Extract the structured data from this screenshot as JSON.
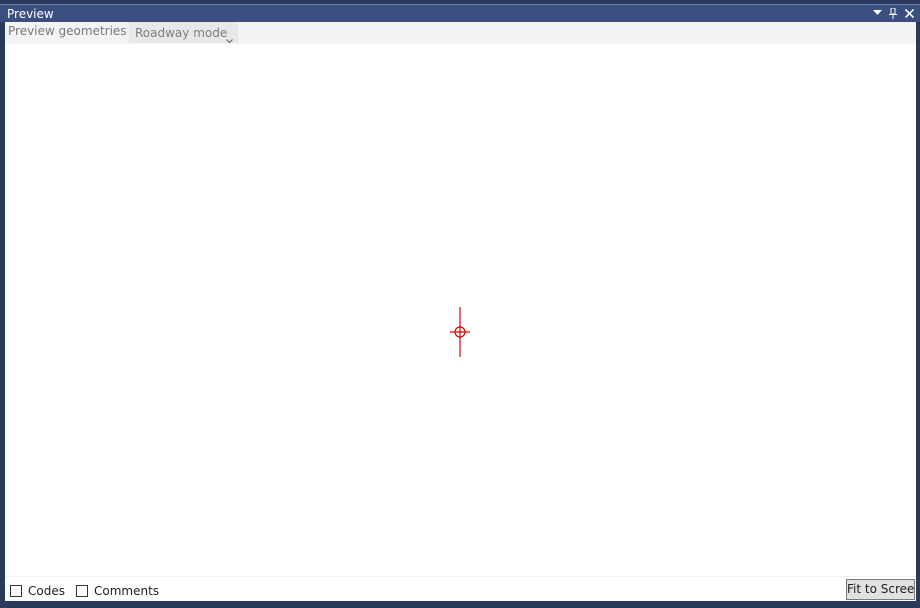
{
  "window": {
    "title": "Preview",
    "title_icons": [
      "dropdown-arrow-icon",
      "pin-icon",
      "close-icon"
    ]
  },
  "toolbar": {
    "label": "Preview geometries in",
    "mode_select": {
      "value": "Roadway mode",
      "icon": "chevron-down-icon"
    }
  },
  "canvas": {
    "marker": "crosshair-origin-icon",
    "marker_color": "#e00000"
  },
  "statusbar": {
    "checkboxes": [
      {
        "label": "Codes",
        "checked": false
      },
      {
        "label": "Comments",
        "checked": false
      }
    ],
    "fit_button_label": "Fit to Screen"
  },
  "colors": {
    "titlebar": "#3b4f81",
    "frame": "#2b3a5c",
    "canvas": "#ffffff"
  }
}
